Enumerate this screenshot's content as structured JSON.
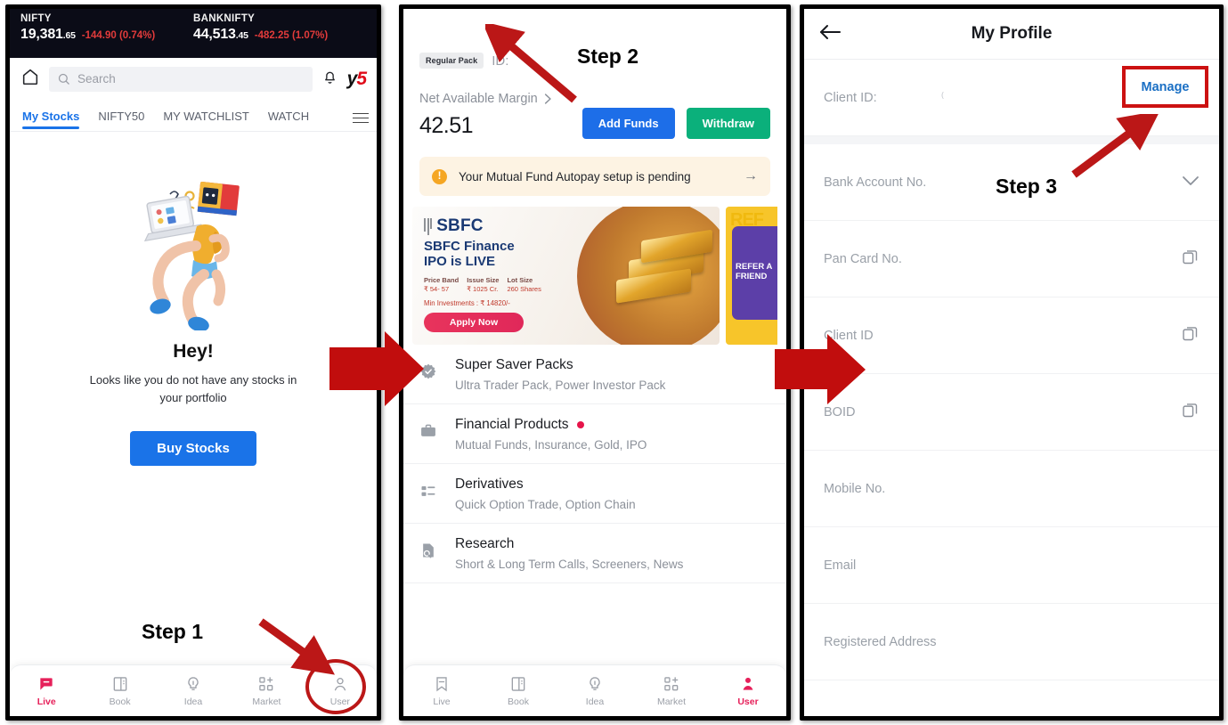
{
  "panel1": {
    "tickers": [
      {
        "name": "NIFTY",
        "price": "19,381",
        "decimals": ".65",
        "change": "-144.90 (0.74%)"
      },
      {
        "name": "BANKNIFTY",
        "price": "44,513",
        "decimals": ".45",
        "change": "-482.25 (1.07%)"
      }
    ],
    "header": {
      "home_icon": "home-icon",
      "search_placeholder": "Search",
      "bell_icon": "bell-icon",
      "logo_y": "y",
      "logo_5": "5"
    },
    "tabs": [
      {
        "label": "My Stocks",
        "active": true
      },
      {
        "label": "NIFTY50",
        "active": false
      },
      {
        "label": "MY WATCHLIST",
        "active": false
      },
      {
        "label": "WATCH",
        "active": false
      }
    ],
    "empty_state": {
      "title": "Hey!",
      "message": "Looks like you do not have any stocks in your portfolio",
      "cta": "Buy Stocks"
    },
    "step_label": "Step 1",
    "bottom_nav": [
      {
        "label": "Live",
        "icon": "chat-icon",
        "active": true
      },
      {
        "label": "Book",
        "icon": "book-icon",
        "active": false
      },
      {
        "label": "Idea",
        "icon": "bulb-icon",
        "active": false
      },
      {
        "label": "Market",
        "icon": "market-icon",
        "active": false
      },
      {
        "label": "User",
        "icon": "user-icon",
        "active": false
      }
    ]
  },
  "panel2": {
    "chevron_icon": "chevron-right-icon",
    "pack_chip": "Regular Pack",
    "id_label": "ID:",
    "step_label": "Step 2",
    "margin_label": "Net Available Margin",
    "margin_value": "42.51",
    "buttons": {
      "add_funds": "Add Funds",
      "withdraw": "Withdraw"
    },
    "autopay": {
      "text": "Your Mutual Fund Autopay setup is pending",
      "icon": "info-icon",
      "arrow": "arrow-right-icon"
    },
    "banner": {
      "brand": "SBFC",
      "headline_l1": "SBFC Finance",
      "headline_l2": "IPO is LIVE",
      "price_band_label": "Price Band",
      "price_band_value": "₹ 54- 57",
      "issue_size_label": "Issue Size",
      "issue_size_value": "₹ 1025 Cr.",
      "lot_size_label": "Lot Size",
      "lot_size_value": "260 Shares",
      "min_investment": "Min Investments : ₹ 14820/-",
      "apply_cta": "Apply Now",
      "refer_ghost": "REF",
      "refer_l1": "REFER A",
      "refer_l2": "FRIEND"
    },
    "features": [
      {
        "title": "Super Saver Packs",
        "subtitle": "Ultra Trader Pack, Power Investor Pack",
        "icon": "verified-badge-icon",
        "badge": false
      },
      {
        "title": "Financial Products",
        "subtitle": "Mutual Funds, Insurance, Gold, IPO",
        "icon": "briefcase-icon",
        "badge": true
      },
      {
        "title": "Derivatives",
        "subtitle": "Quick Option Trade, Option Chain",
        "icon": "list-icon",
        "badge": false
      },
      {
        "title": "Research",
        "subtitle": "Short & Long Term Calls, Screeners, News",
        "icon": "document-search-icon",
        "badge": false
      }
    ],
    "bottom_nav": [
      {
        "label": "Live",
        "icon": "bookmark-icon",
        "active": false
      },
      {
        "label": "Book",
        "icon": "book-icon",
        "active": false
      },
      {
        "label": "Idea",
        "icon": "bulb-icon",
        "active": false
      },
      {
        "label": "Market",
        "icon": "market-icon",
        "active": false
      },
      {
        "label": "User",
        "icon": "user-icon",
        "active": true
      }
    ]
  },
  "panel3": {
    "back_icon": "arrow-left-icon",
    "title": "My Profile",
    "step_label": "Step 3",
    "manage_label": "Manage",
    "rows": [
      {
        "label": "Client ID:",
        "action": "manage",
        "icon": ""
      },
      {
        "label": "Bank Account No.",
        "action": "",
        "icon": "chevron-down-icon"
      },
      {
        "label": "Pan Card No.",
        "action": "",
        "icon": "copy-icon"
      },
      {
        "label": "Client ID",
        "action": "",
        "icon": "copy-icon"
      },
      {
        "label": "BOID",
        "action": "",
        "icon": "copy-icon"
      },
      {
        "label": "Mobile No.",
        "action": "",
        "icon": ""
      },
      {
        "label": "Email",
        "action": "",
        "icon": ""
      },
      {
        "label": "Registered Address",
        "action": "",
        "icon": ""
      }
    ]
  },
  "colors": {
    "accent_blue": "#1a73e8",
    "accent_red": "#cc1111",
    "accent_green": "#0bb07b",
    "accent_pink": "#e6205a",
    "arrow_red": "#cc1111"
  }
}
